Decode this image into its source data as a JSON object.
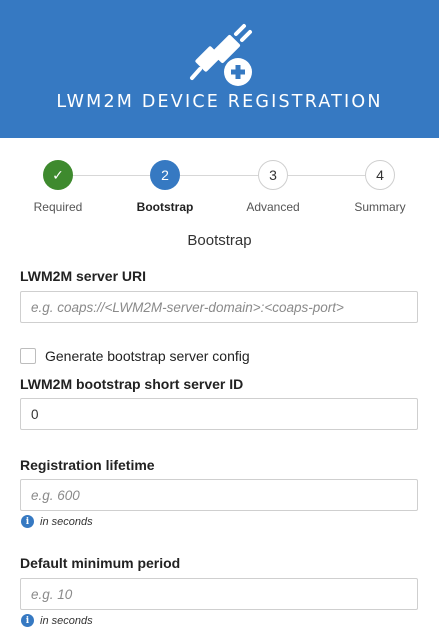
{
  "header": {
    "title": "LWM2M DEVICE REGISTRATION",
    "icon": "plug-add-icon"
  },
  "stepper": {
    "steps": [
      {
        "label": "Required",
        "marker": "✓",
        "state": "done"
      },
      {
        "label": "Bootstrap",
        "marker": "2",
        "state": "active"
      },
      {
        "label": "Advanced",
        "marker": "3",
        "state": "todo"
      },
      {
        "label": "Summary",
        "marker": "4",
        "state": "todo"
      }
    ]
  },
  "section_title": "Bootstrap",
  "form": {
    "server_uri": {
      "label": "LWM2M server URI",
      "value": "",
      "placeholder": "e.g. coaps://<LWM2M-server-domain>:<coaps-port>"
    },
    "generate_bootstrap": {
      "label": "Generate bootstrap server config",
      "checked": false
    },
    "short_server_id": {
      "label": "LWM2M bootstrap short server ID",
      "value": "0",
      "placeholder": ""
    },
    "registration_lifetime": {
      "label": "Registration lifetime",
      "value": "",
      "placeholder": "e.g. 600",
      "hint": "in seconds"
    },
    "default_min_period": {
      "label": "Default minimum period",
      "value": "",
      "placeholder": "e.g. 10",
      "hint": "in seconds"
    }
  },
  "colors": {
    "header_bg": "#3679c2",
    "step_done": "#3e8a2e",
    "step_active": "#3679c2"
  }
}
